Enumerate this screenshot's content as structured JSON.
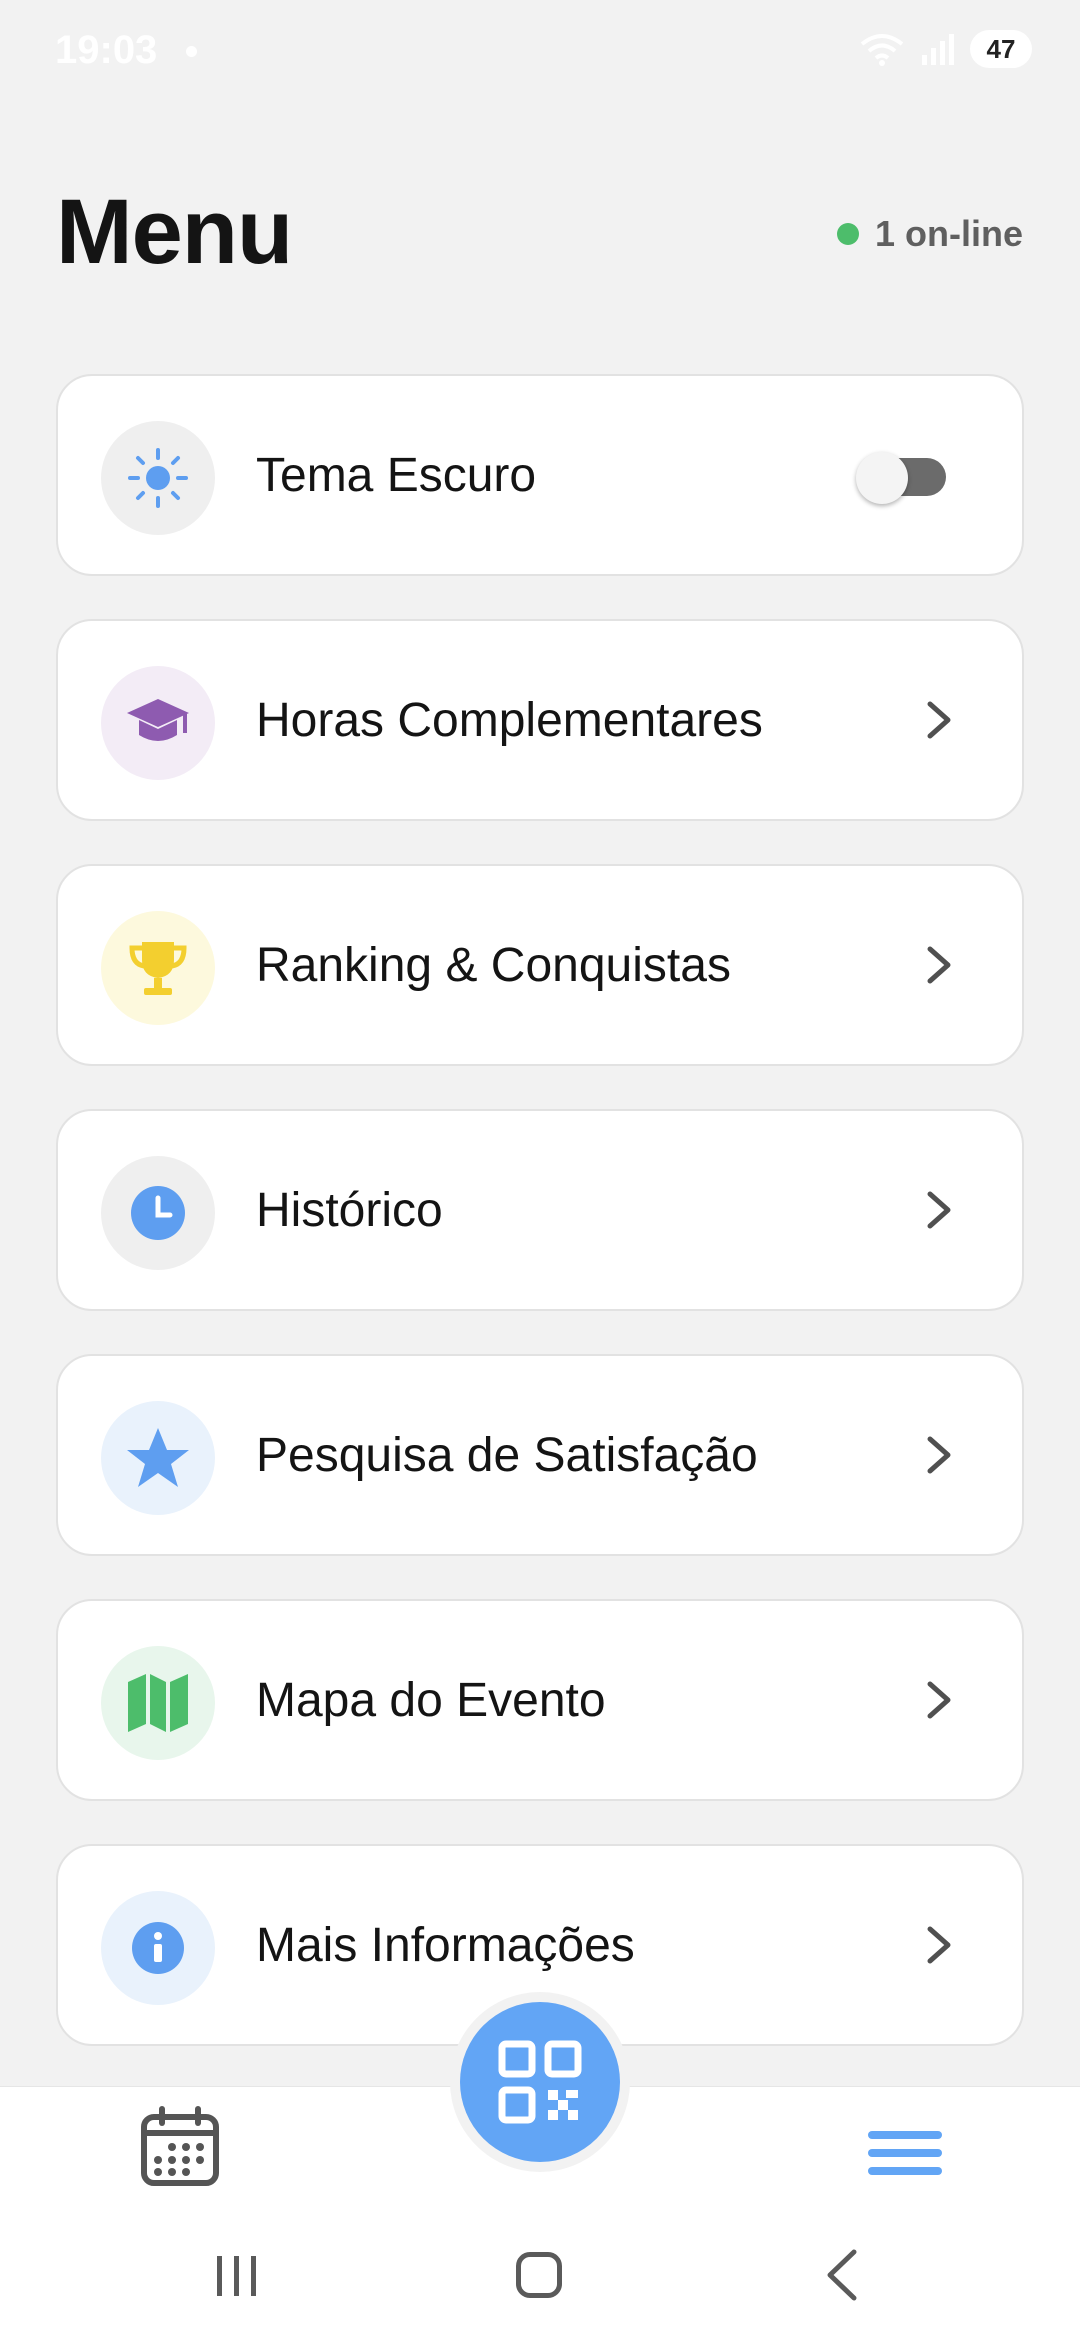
{
  "status_bar": {
    "time": "19:03",
    "battery": "47"
  },
  "header": {
    "title": "Menu",
    "online_text": "1 on-line",
    "online_color": "#4dbd6b"
  },
  "menu": [
    {
      "name": "theme-toggle",
      "label": "Tema Escuro",
      "icon": "sun-icon",
      "icon_bg": "#efefef",
      "icon_color": "#5e9ef0",
      "control": "toggle",
      "toggle_on": false
    },
    {
      "name": "complementary-hours",
      "label": "Horas Complementares",
      "icon": "graduation-cap-icon",
      "icon_bg": "#f3ecf6",
      "icon_color": "#8e5bb0",
      "control": "chevron"
    },
    {
      "name": "ranking-achievements",
      "label": "Ranking & Conquistas",
      "icon": "trophy-icon",
      "icon_bg": "#fdf9dd",
      "icon_color": "#f3cf2f",
      "control": "chevron"
    },
    {
      "name": "history",
      "label": "Histórico",
      "icon": "clock-icon",
      "icon_bg": "#efefef",
      "icon_color": "#5e9ef0",
      "control": "chevron"
    },
    {
      "name": "satisfaction-survey",
      "label": "Pesquisa de Satisfação",
      "icon": "star-icon",
      "icon_bg": "#e9f2fc",
      "icon_color": "#5e9ef0",
      "control": "chevron"
    },
    {
      "name": "event-map",
      "label": "Mapa do Evento",
      "icon": "map-icon",
      "icon_bg": "#e8f6ec",
      "icon_color": "#4dbd6b",
      "control": "chevron"
    },
    {
      "name": "more-info",
      "label": "Mais Informações",
      "icon": "info-icon",
      "icon_bg": "#e9f2fc",
      "icon_color": "#5e9ef0",
      "control": "chevron"
    }
  ],
  "bottom_nav": {
    "left_icon": "calendar-icon",
    "center_icon": "qr-code-icon",
    "right_icon": "hamburger-menu-icon",
    "accent_color": "#62a5f5"
  }
}
